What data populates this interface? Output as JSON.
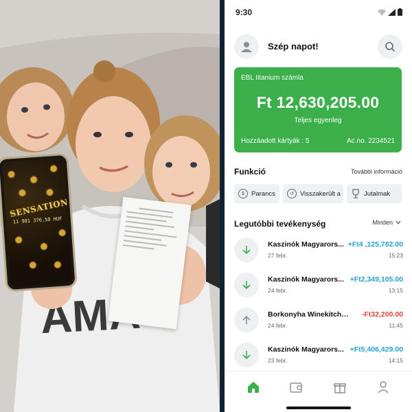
{
  "status_bar": {
    "time": "9:30"
  },
  "header": {
    "greeting": "Szép napot!"
  },
  "account_card": {
    "name": "EBL titanium számla",
    "balance": "Ft 12,630,205.00",
    "balance_label": "Teljes egyenleg",
    "added_cards": "Hozzáadott kártyák : 5",
    "account_no": "Ac.no. 2234521",
    "color": "#3bb04a"
  },
  "functions": {
    "title": "Funkció",
    "more_link": "További információ",
    "buttons": [
      {
        "label": "Parancs",
        "icon": "command-icon"
      },
      {
        "label": "Visszakerült a",
        "icon": "refund-icon"
      },
      {
        "label": "Jutalmak",
        "icon": "trophy-icon"
      }
    ]
  },
  "activity": {
    "title": "Legutóbbi tevékenység",
    "filter_label": "Minden",
    "items": [
      {
        "name": "Kaszinók Magyarors...",
        "date": "27 febr.",
        "amount": "+Ft4 ,125,782.00",
        "time": "15:23",
        "direction": "in"
      },
      {
        "name": "Kaszinók Magyarors...",
        "date": "24 febr.",
        "amount": "+Ft2,349,105.00",
        "time": "13:15",
        "direction": "in"
      },
      {
        "name": "Borkonyha Winekitchen",
        "date": "24 febr.",
        "amount": "-Ft32,200.00",
        "time": "11:45",
        "direction": "out"
      },
      {
        "name": "Kaszinók Magyarors...",
        "date": "23 febr.",
        "amount": "+Ft5,406,429.00",
        "time": "14:15",
        "direction": "in"
      }
    ]
  },
  "colors": {
    "accent": "#3bb04a",
    "positive": "#2a9fd8",
    "negative": "#e0453b"
  },
  "photo": {
    "phone_screen_text": "SENSATIONAL",
    "phone_screen_amount": "11 981 376,50 HUF"
  },
  "bottom_nav": [
    "home-icon",
    "wallet-icon",
    "gift-icon",
    "profile-icon"
  ]
}
